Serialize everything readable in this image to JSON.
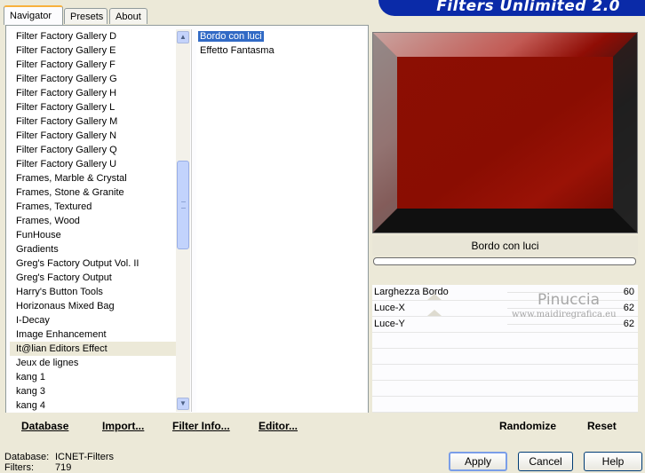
{
  "tabs": {
    "navigator": "Navigator",
    "presets": "Presets",
    "about": "About"
  },
  "brand": "Filters Unlimited 2.0",
  "categories": [
    "Filter Factory Gallery D",
    "Filter Factory Gallery E",
    "Filter Factory Gallery F",
    "Filter Factory Gallery G",
    "Filter Factory Gallery H",
    "Filter Factory Gallery L",
    "Filter Factory Gallery M",
    "Filter Factory Gallery N",
    "Filter Factory Gallery Q",
    "Filter Factory Gallery U",
    "Frames, Marble & Crystal",
    "Frames, Stone & Granite",
    "Frames, Textured",
    "Frames, Wood",
    "FunHouse",
    "Gradients",
    "Greg's Factory Output Vol. II",
    "Greg's Factory Output",
    "Harry's Button Tools",
    "Horizonaus Mixed Bag",
    "I-Decay",
    "Image Enhancement",
    "It@lian Editors Effect",
    "Jeux de lignes",
    "kang 1",
    "kang 3",
    "kang 4"
  ],
  "selected_category": "It@lian Editors Effect",
  "filters": [
    "Bordo con luci",
    "Effetto Fantasma"
  ],
  "selected_filter": "Bordo con luci",
  "left_buttons": {
    "database": "Database",
    "import": "Import...",
    "filter_info": "Filter Info...",
    "editor": "Editor..."
  },
  "preview_filter_name": "Bordo con luci",
  "parameters": [
    {
      "name": "Larghezza Bordo",
      "value": "60"
    },
    {
      "name": "Luce-X",
      "value": "62"
    },
    {
      "name": "Luce-Y",
      "value": "62"
    }
  ],
  "watermark": {
    "line1": "Pinuccia",
    "line2": "www.maidiregrafica.eu"
  },
  "right_buttons": {
    "randomize": "Randomize",
    "reset": "Reset"
  },
  "footer": {
    "database_label": "Database:",
    "database_value": "ICNET-Filters",
    "filters_label": "Filters:",
    "filters_value": "719"
  },
  "dialog_buttons": {
    "apply": "Apply",
    "cancel": "Cancel",
    "help": "Help"
  },
  "colors": {
    "tab_highlight": "#f8b13d",
    "selection": "#316ac5",
    "brand_band": "#0a2aa8",
    "preview_red": "#8a0d02"
  }
}
